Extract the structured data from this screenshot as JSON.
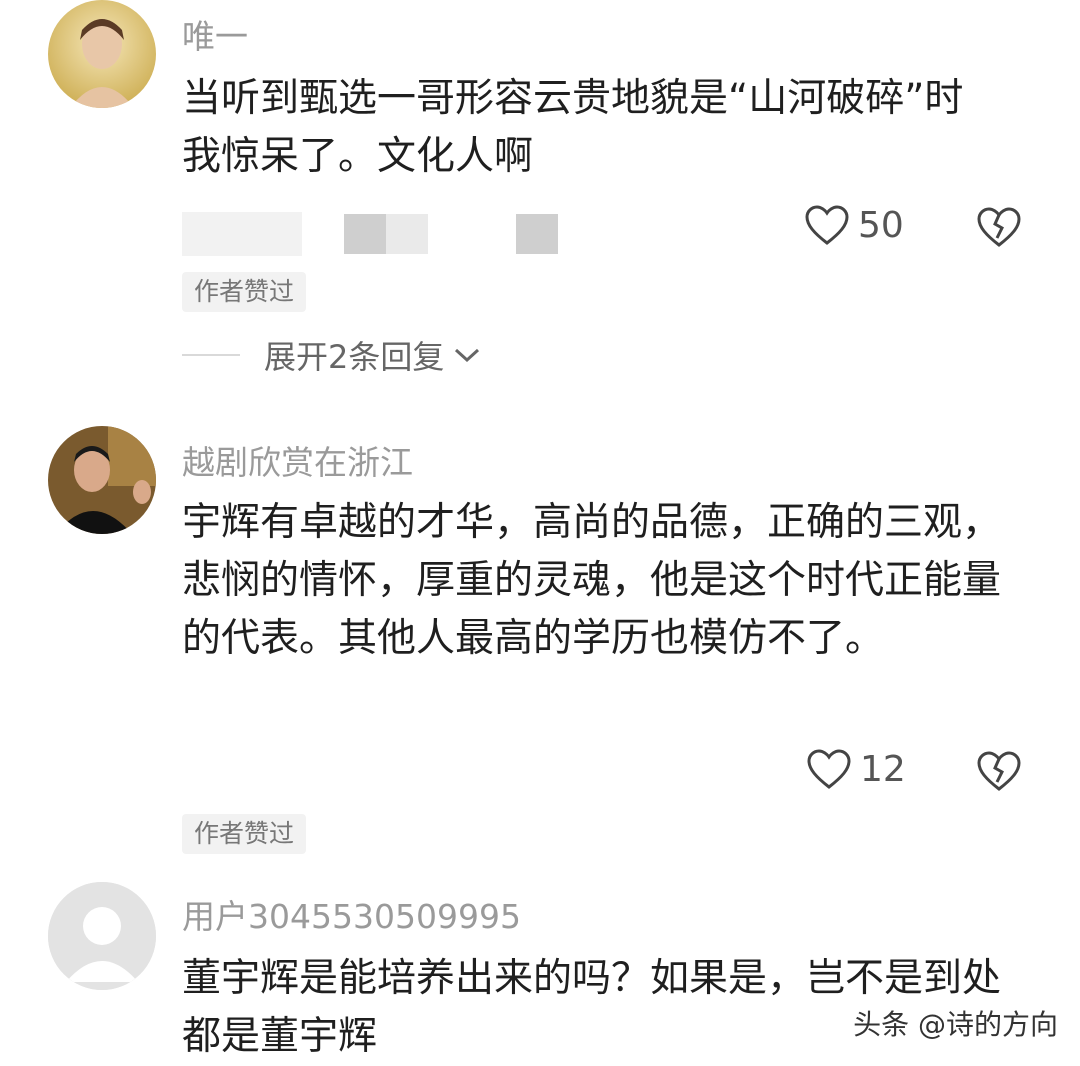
{
  "comments": [
    {
      "username": "唯一",
      "text": "当听到甄选一哥形容云贵地貌是“山河破碎”时我惊呆了。文化人啊",
      "likes": "50",
      "badge": "作者赞过",
      "replies": "展开2条回复"
    },
    {
      "username": "越剧欣赏在浙江",
      "text": "宇辉有卓越的才华，高尚的品德，正确的三观，悲悯的情怀，厚重的灵魂，他是这个时代正能量的代表。其他人最高的学历也模仿不了。",
      "likes": "12",
      "badge": "作者赞过"
    },
    {
      "username": "用户3045530509995",
      "text": "董宇辉是能培养出来的吗？如果是，岂不是到处都是董宇辉"
    }
  ],
  "watermark": "头条 @诗的方向",
  "icons": {
    "like": "heart-outline-icon",
    "dislike": "broken-heart-icon",
    "expand": "chevron-down-icon",
    "default_avatar": "default-user-avatar-icon"
  },
  "colors": {
    "username": "#9a9a9a",
    "text": "#1f1f1f",
    "badge_bg": "#f2f2f2"
  }
}
